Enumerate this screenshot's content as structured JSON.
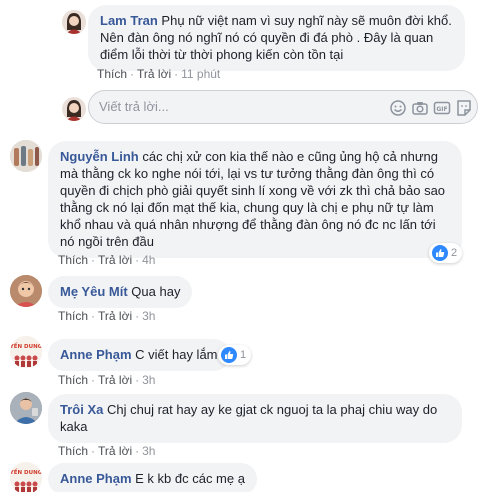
{
  "comments": [
    {
      "name": "Lam Tran",
      "text": "Phụ nữ việt nam vì suy nghĩ này sẽ muôn đời khổ. Nên đàn ông nó nghĩ nó có quyền đi đá phò . Đây là quan điểm lỗi thời từ thời phong kiến còn tồn tại",
      "like": "Thích",
      "reply": "Trả lời",
      "time": "11 phút"
    },
    {
      "name": "Nguyễn Linh",
      "text": "các chị xử con kia thế nào e cũng ủng hộ cả nhưng mà thằng ck ko nghe nói tới, lại vs tư tưởng thằng đàn ông thì có quyền đi chịch phò giải quyết sinh lí xong về với zk thì chả bảo sao thằng ck nó lại đốn mạt thế kia, chung quy là chị e phụ nữ tự làm khổ nhau và quá nhân nhượng để thằng đàn ông nó đc nc lấn tới nó ngồi trên đầu",
      "like": "Thích",
      "reply": "Trả lời",
      "time": "4h",
      "reaction_count": "2"
    },
    {
      "name": "Mẹ Yêu Mít",
      "text": "Qua hay",
      "like": "Thích",
      "reply": "Trả lời",
      "time": "3h"
    },
    {
      "name": "Anne Phạm",
      "text": "C viết hay lắm",
      "like": "Thích",
      "reply": "Trả lời",
      "time": "3h",
      "reaction_count": "1",
      "avatar_text": "YẾN DUNG"
    },
    {
      "name": "Trôi Xa",
      "text": "Chj chuj rat hay ay ke gjat ck nguoj ta la phaj chiu way do kaka",
      "like": "Thích",
      "reply": "Trả lời",
      "time": "3h"
    },
    {
      "name": "Anne Phạm",
      "text": "E k kb đc các mẹ ạ",
      "avatar_text": "YẾN DUNG"
    }
  ],
  "reply_box": {
    "placeholder": "Viết trả lời..."
  },
  "colors": {
    "name_link": "#385898",
    "bubble_bg": "#f2f3f5",
    "meta_gray": "#90949c",
    "like_blue": "#2e89ff"
  }
}
